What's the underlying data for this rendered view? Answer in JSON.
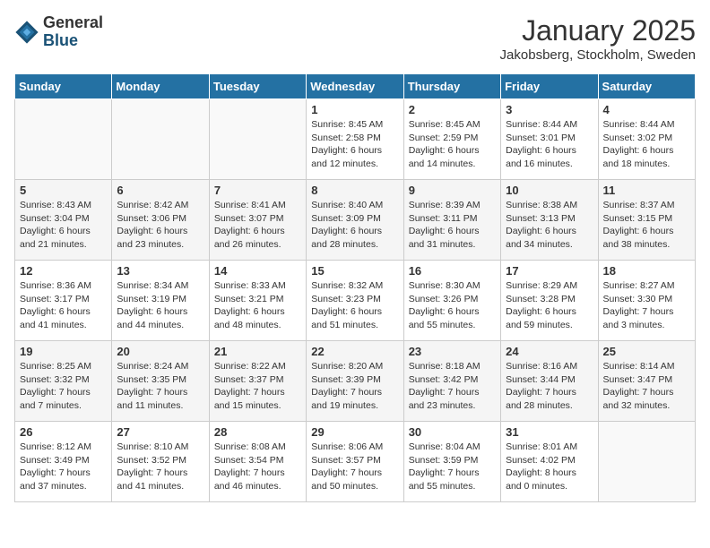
{
  "header": {
    "logo_general": "General",
    "logo_blue": "Blue",
    "month_title": "January 2025",
    "location": "Jakobsberg, Stockholm, Sweden"
  },
  "days_of_week": [
    "Sunday",
    "Monday",
    "Tuesday",
    "Wednesday",
    "Thursday",
    "Friday",
    "Saturday"
  ],
  "weeks": [
    [
      {
        "day": "",
        "info": ""
      },
      {
        "day": "",
        "info": ""
      },
      {
        "day": "",
        "info": ""
      },
      {
        "day": "1",
        "info": "Sunrise: 8:45 AM\nSunset: 2:58 PM\nDaylight: 6 hours\nand 12 minutes."
      },
      {
        "day": "2",
        "info": "Sunrise: 8:45 AM\nSunset: 2:59 PM\nDaylight: 6 hours\nand 14 minutes."
      },
      {
        "day": "3",
        "info": "Sunrise: 8:44 AM\nSunset: 3:01 PM\nDaylight: 6 hours\nand 16 minutes."
      },
      {
        "day": "4",
        "info": "Sunrise: 8:44 AM\nSunset: 3:02 PM\nDaylight: 6 hours\nand 18 minutes."
      }
    ],
    [
      {
        "day": "5",
        "info": "Sunrise: 8:43 AM\nSunset: 3:04 PM\nDaylight: 6 hours\nand 21 minutes."
      },
      {
        "day": "6",
        "info": "Sunrise: 8:42 AM\nSunset: 3:06 PM\nDaylight: 6 hours\nand 23 minutes."
      },
      {
        "day": "7",
        "info": "Sunrise: 8:41 AM\nSunset: 3:07 PM\nDaylight: 6 hours\nand 26 minutes."
      },
      {
        "day": "8",
        "info": "Sunrise: 8:40 AM\nSunset: 3:09 PM\nDaylight: 6 hours\nand 28 minutes."
      },
      {
        "day": "9",
        "info": "Sunrise: 8:39 AM\nSunset: 3:11 PM\nDaylight: 6 hours\nand 31 minutes."
      },
      {
        "day": "10",
        "info": "Sunrise: 8:38 AM\nSunset: 3:13 PM\nDaylight: 6 hours\nand 34 minutes."
      },
      {
        "day": "11",
        "info": "Sunrise: 8:37 AM\nSunset: 3:15 PM\nDaylight: 6 hours\nand 38 minutes."
      }
    ],
    [
      {
        "day": "12",
        "info": "Sunrise: 8:36 AM\nSunset: 3:17 PM\nDaylight: 6 hours\nand 41 minutes."
      },
      {
        "day": "13",
        "info": "Sunrise: 8:34 AM\nSunset: 3:19 PM\nDaylight: 6 hours\nand 44 minutes."
      },
      {
        "day": "14",
        "info": "Sunrise: 8:33 AM\nSunset: 3:21 PM\nDaylight: 6 hours\nand 48 minutes."
      },
      {
        "day": "15",
        "info": "Sunrise: 8:32 AM\nSunset: 3:23 PM\nDaylight: 6 hours\nand 51 minutes."
      },
      {
        "day": "16",
        "info": "Sunrise: 8:30 AM\nSunset: 3:26 PM\nDaylight: 6 hours\nand 55 minutes."
      },
      {
        "day": "17",
        "info": "Sunrise: 8:29 AM\nSunset: 3:28 PM\nDaylight: 6 hours\nand 59 minutes."
      },
      {
        "day": "18",
        "info": "Sunrise: 8:27 AM\nSunset: 3:30 PM\nDaylight: 7 hours\nand 3 minutes."
      }
    ],
    [
      {
        "day": "19",
        "info": "Sunrise: 8:25 AM\nSunset: 3:32 PM\nDaylight: 7 hours\nand 7 minutes."
      },
      {
        "day": "20",
        "info": "Sunrise: 8:24 AM\nSunset: 3:35 PM\nDaylight: 7 hours\nand 11 minutes."
      },
      {
        "day": "21",
        "info": "Sunrise: 8:22 AM\nSunset: 3:37 PM\nDaylight: 7 hours\nand 15 minutes."
      },
      {
        "day": "22",
        "info": "Sunrise: 8:20 AM\nSunset: 3:39 PM\nDaylight: 7 hours\nand 19 minutes."
      },
      {
        "day": "23",
        "info": "Sunrise: 8:18 AM\nSunset: 3:42 PM\nDaylight: 7 hours\nand 23 minutes."
      },
      {
        "day": "24",
        "info": "Sunrise: 8:16 AM\nSunset: 3:44 PM\nDaylight: 7 hours\nand 28 minutes."
      },
      {
        "day": "25",
        "info": "Sunrise: 8:14 AM\nSunset: 3:47 PM\nDaylight: 7 hours\nand 32 minutes."
      }
    ],
    [
      {
        "day": "26",
        "info": "Sunrise: 8:12 AM\nSunset: 3:49 PM\nDaylight: 7 hours\nand 37 minutes."
      },
      {
        "day": "27",
        "info": "Sunrise: 8:10 AM\nSunset: 3:52 PM\nDaylight: 7 hours\nand 41 minutes."
      },
      {
        "day": "28",
        "info": "Sunrise: 8:08 AM\nSunset: 3:54 PM\nDaylight: 7 hours\nand 46 minutes."
      },
      {
        "day": "29",
        "info": "Sunrise: 8:06 AM\nSunset: 3:57 PM\nDaylight: 7 hours\nand 50 minutes."
      },
      {
        "day": "30",
        "info": "Sunrise: 8:04 AM\nSunset: 3:59 PM\nDaylight: 7 hours\nand 55 minutes."
      },
      {
        "day": "31",
        "info": "Sunrise: 8:01 AM\nSunset: 4:02 PM\nDaylight: 8 hours\nand 0 minutes."
      },
      {
        "day": "",
        "info": ""
      }
    ]
  ]
}
